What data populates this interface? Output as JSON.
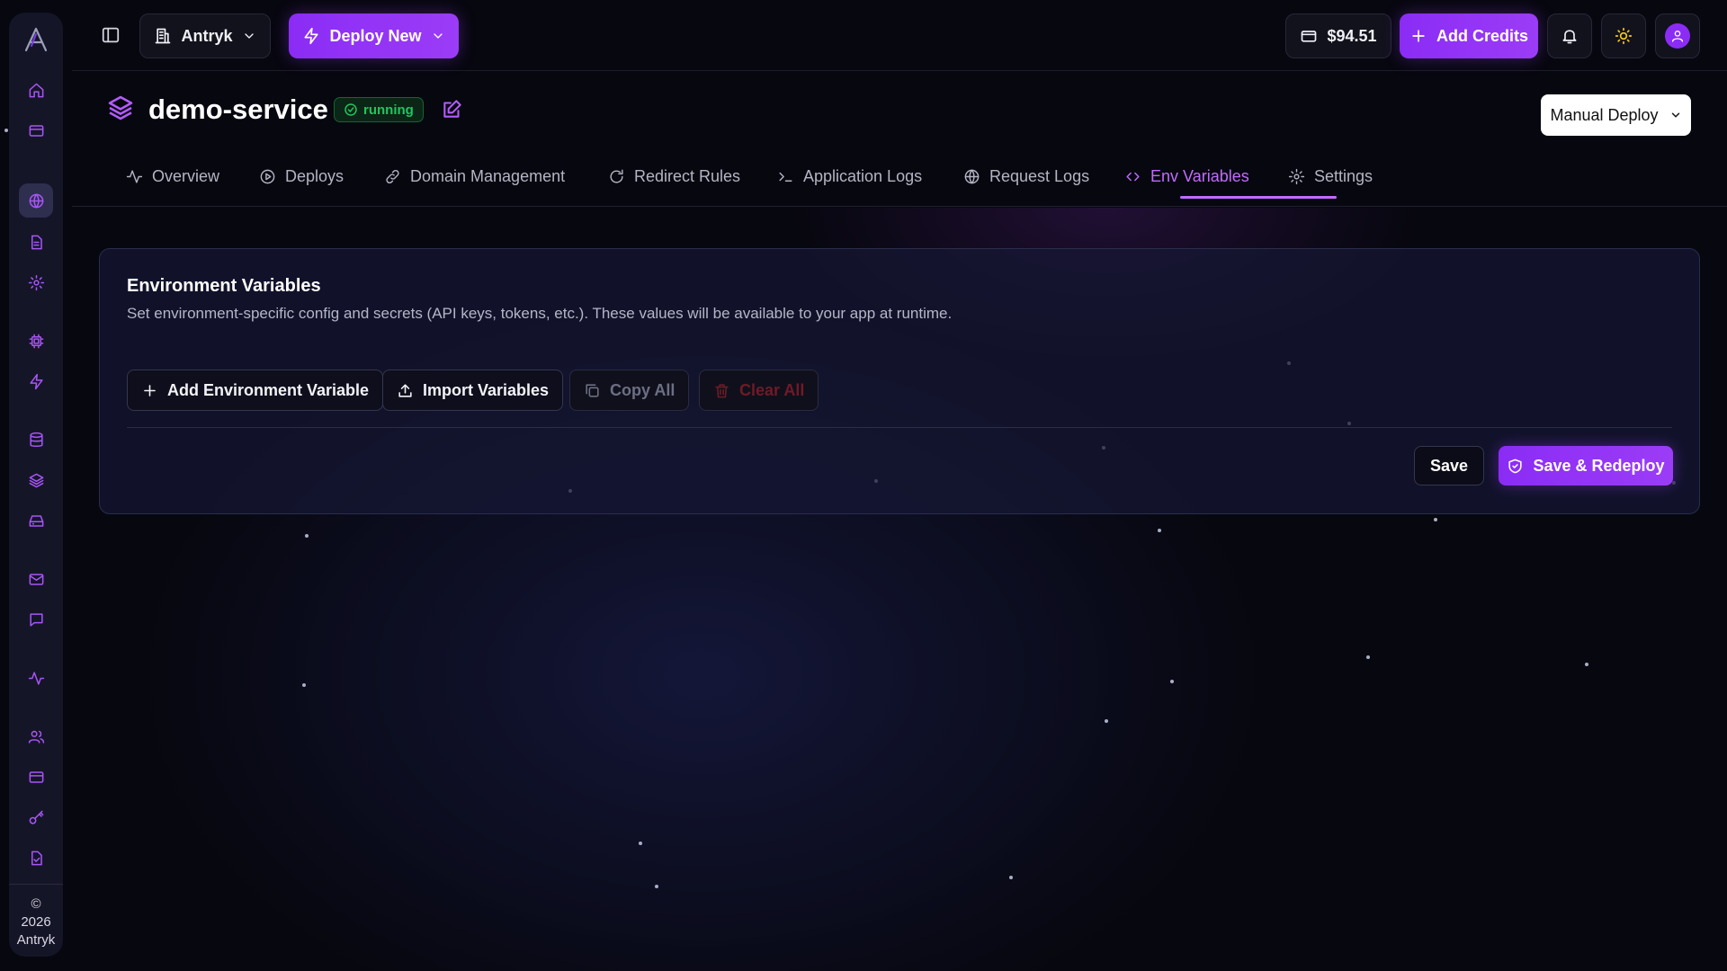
{
  "colors": {
    "accent": "#a855f7",
    "success": "#22c55e",
    "danger": "#6e1b26",
    "background": "#07070f"
  },
  "sidebar": {
    "logo_icon": "antryk-logo-icon",
    "items": [
      {
        "icon": "home-icon"
      },
      {
        "icon": "server-icon"
      },
      {
        "icon": "globe-icon",
        "active": true
      },
      {
        "icon": "document-icon"
      },
      {
        "icon": "gear-icon"
      },
      {
        "icon": "cpu-icon"
      },
      {
        "icon": "bolt-icon"
      },
      {
        "icon": "database-icon"
      },
      {
        "icon": "layers-icon"
      },
      {
        "icon": "storage-icon"
      },
      {
        "icon": "mail-icon"
      },
      {
        "icon": "chat-icon"
      },
      {
        "icon": "activity-icon"
      },
      {
        "icon": "users-icon"
      },
      {
        "icon": "credit-card-icon"
      },
      {
        "icon": "key-icon"
      },
      {
        "icon": "file-check-icon"
      }
    ],
    "footer_copyright": "©",
    "footer_year": "2026",
    "footer_brand": "Antryk"
  },
  "topbar": {
    "org_name": "Antryk",
    "deploy_label": "Deploy New",
    "balance": "$94.51",
    "add_credits_label": "Add Credits"
  },
  "service": {
    "name": "demo-service",
    "status": "running",
    "manual_deploy_label": "Manual Deploy"
  },
  "tabs": [
    {
      "label": "Overview",
      "icon": "activity-icon"
    },
    {
      "label": "Deploys",
      "icon": "play-circle-icon"
    },
    {
      "label": "Domain Management",
      "icon": "link-icon"
    },
    {
      "label": "Redirect Rules",
      "icon": "refresh-icon"
    },
    {
      "label": "Application Logs",
      "icon": "terminal-icon"
    },
    {
      "label": "Request Logs",
      "icon": "globe-icon"
    },
    {
      "label": "Env Variables",
      "icon": "code-icon",
      "active": true
    },
    {
      "label": "Settings",
      "icon": "gear-icon"
    }
  ],
  "env_card": {
    "title": "Environment Variables",
    "description": "Set environment-specific config and secrets (API keys, tokens, etc.). These values will be available to your app at runtime.",
    "add_label": "Add Environment Variable",
    "import_label": "Import Variables",
    "copy_label": "Copy All",
    "clear_label": "Clear All",
    "save_label": "Save",
    "save_redeploy_label": "Save & Redeploy"
  }
}
